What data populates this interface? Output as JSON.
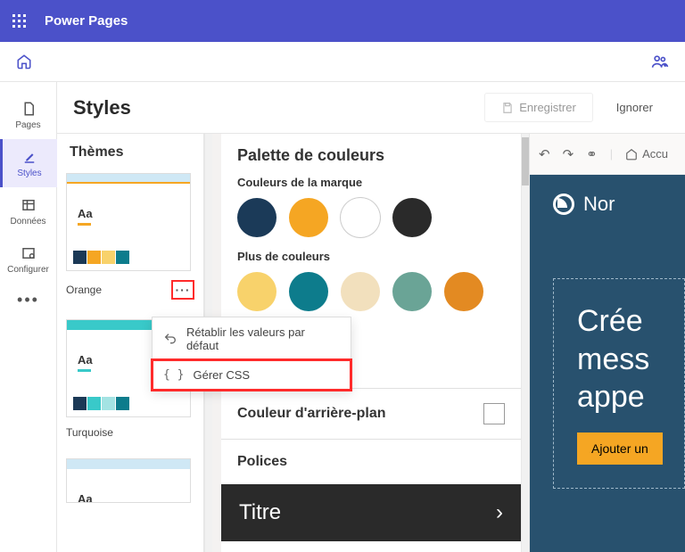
{
  "app": {
    "name": "Power Pages"
  },
  "sidenav": {
    "pages": "Pages",
    "styles": "Styles",
    "donnees": "Données",
    "configurer": "Configurer"
  },
  "workspace": {
    "title": "Styles",
    "save": "Enregistrer",
    "ignore": "Ignorer"
  },
  "themes": {
    "heading": "Thèmes",
    "orange": "Orange",
    "turquoise": "Turquoise"
  },
  "flyout": {
    "reset": "Rétablir les valeurs par défaut",
    "manage_css": "Gérer CSS"
  },
  "palette": {
    "heading": "Palette de couleurs",
    "brand": "Couleurs de la marque",
    "more": "Plus de couleurs",
    "brand_colors": [
      "#1b3a58",
      "#f5a623",
      "#ffffff",
      "#2a2a2a"
    ],
    "more_colors": [
      "#f8d26b",
      "#0d7c8c",
      "#f2e0bd",
      "#6aa496",
      "#e38a22"
    ],
    "bg_section": "Couleur d'arrière-plan",
    "fonts_section": "Polices",
    "title_row": "Titre"
  },
  "preview": {
    "toolbar_home": "Accu",
    "brand": "Nor",
    "hero_l1": "Crée",
    "hero_l2": "mess",
    "hero_l3": "appe",
    "cta": "Ajouter un"
  }
}
